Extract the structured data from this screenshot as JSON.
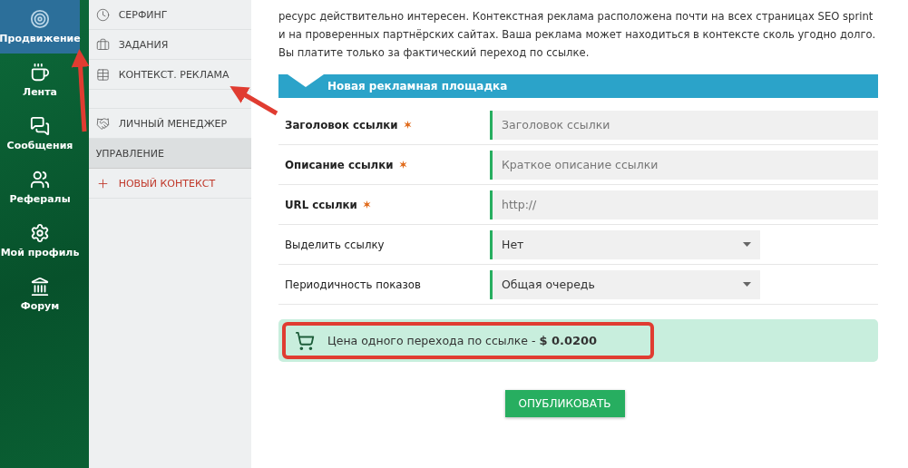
{
  "nav": {
    "items": [
      {
        "label": "Продвижение",
        "selected": true
      },
      {
        "label": "Лента",
        "selected": false
      },
      {
        "label": "Сообщения",
        "selected": false
      },
      {
        "label": "Рефералы",
        "selected": false
      },
      {
        "label": "Мой профиль",
        "selected": false
      },
      {
        "label": "Форум",
        "selected": false
      }
    ]
  },
  "submenu": {
    "sections": [
      {
        "items": [
          {
            "label": "СЕРФИНГ",
            "kind": "link"
          },
          {
            "label": "ЗАДАНИЯ",
            "kind": "link"
          },
          {
            "label": "КОНТЕКСТ. РЕКЛАМА",
            "kind": "link"
          }
        ]
      },
      {
        "items": [
          {
            "label": "ЛИЧНЫЙ МЕНЕДЖЕР",
            "kind": "link"
          }
        ]
      },
      {
        "header": "УПРАВЛЕНИЕ",
        "items": [
          {
            "label": "НОВЫЙ КОНТЕКСТ",
            "kind": "action"
          }
        ]
      }
    ]
  },
  "intro": "ресурс действительно интересен. Контекстная реклама расположена почти на всех страницах SEO sprint и на проверенных партнёрских сайтах. Ваша реклама может находиться в контексте сколь угодно долго. Вы платите только за фактический переход по ссылке.",
  "form": {
    "title": "Новая рекламная площадка",
    "fields": [
      {
        "label": "Заголовок ссылки",
        "required": true,
        "kind": "text",
        "placeholder": "Заголовок ссылки"
      },
      {
        "label": "Описание ссылки",
        "required": true,
        "kind": "text",
        "placeholder": "Краткое описание ссылки"
      },
      {
        "label": "URL ссылки",
        "required": true,
        "kind": "text",
        "placeholder": "http://"
      },
      {
        "label": "Выделить ссылку",
        "required": false,
        "kind": "select",
        "value": "Нет"
      },
      {
        "label": "Периодичность показов",
        "required": false,
        "kind": "select",
        "value": "Общая очередь"
      }
    ]
  },
  "price": {
    "text": "Цена одного перехода по ссылке - **$ 0.0200**",
    "highlighted": true
  },
  "submit": "ОПУБЛИКОВАТЬ"
}
